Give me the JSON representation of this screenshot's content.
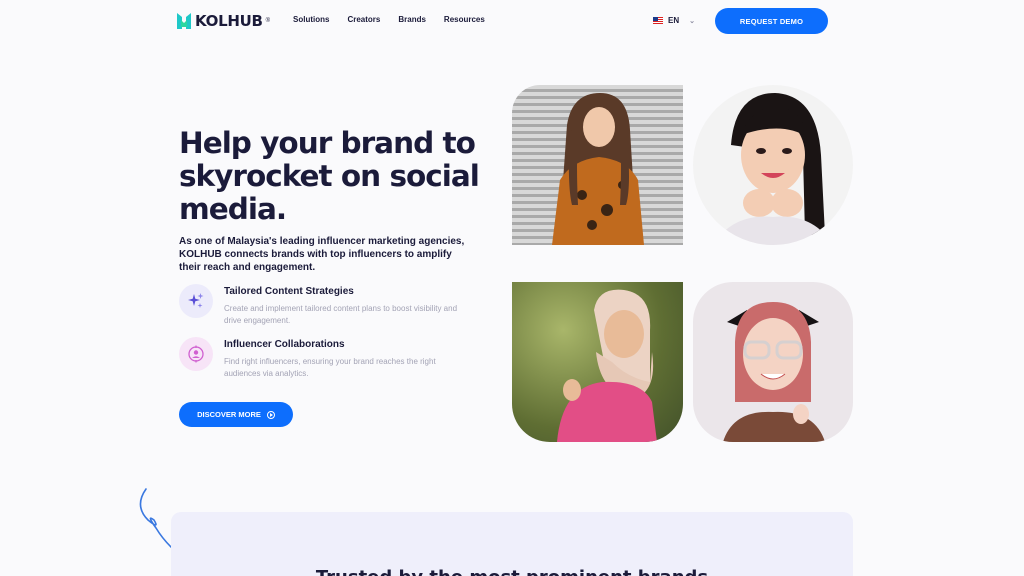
{
  "nav": {
    "logo_text": "KOLHUB",
    "logo_reg": "®",
    "links": [
      "Solutions",
      "Creators",
      "Brands",
      "Resources"
    ],
    "language": "EN",
    "demo_label": "REQUEST DEMO"
  },
  "hero": {
    "title": "Help your brand to skyrocket on social media.",
    "description": "As one of Malaysia's leading influencer marketing agencies, KOLHUB connects brands with top influencers to amplify their reach and engagement.",
    "features": [
      {
        "title": "Tailored Content Strategies",
        "description": "Create and implement tailored content plans to boost visibility and drive engagement.",
        "icon": "sparkles-icon"
      },
      {
        "title": "Influencer Collaborations",
        "description": "Find right influencers, ensuring your brand reaches the right audiences via analytics.",
        "icon": "influencer-target-icon"
      }
    ],
    "cta_label": "DISCOVER MORE"
  },
  "trusted": {
    "title": "Trusted by the most prominent brands"
  },
  "colors": {
    "accent": "#0d6efd",
    "text": "#1b1b3a",
    "muted": "#a3a3b5"
  }
}
